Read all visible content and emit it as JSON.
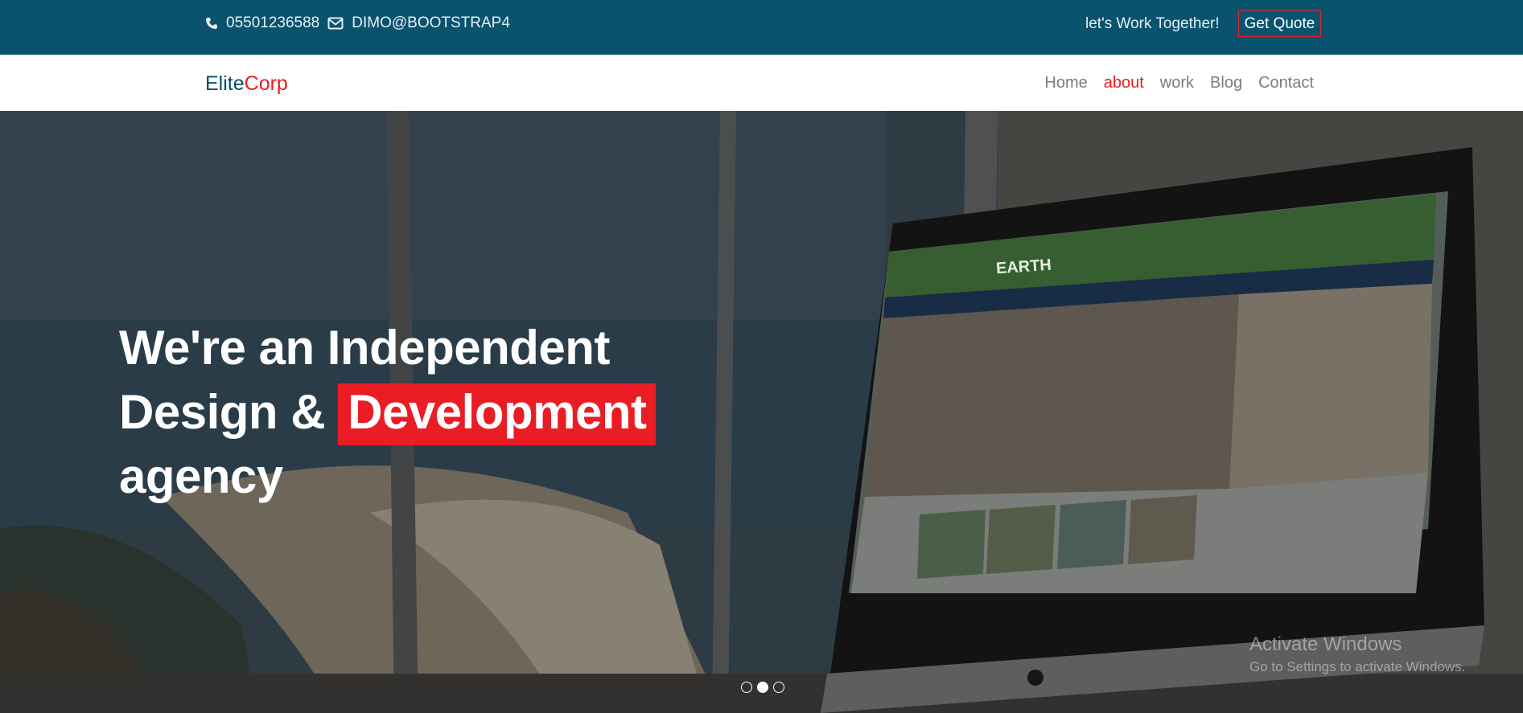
{
  "topbar": {
    "phone": "05501236588",
    "email": "DIMO@BOOTSTRAP4",
    "tagline": "let's Work Together!",
    "quote_button": "Get Quote"
  },
  "navbar": {
    "brand_part1": "Elite",
    "brand_part2": "Corp",
    "links": [
      "Home",
      "about",
      "work",
      "Blog",
      "Contact"
    ],
    "active_link": "about"
  },
  "hero": {
    "line1": "We're an Independent",
    "line2_prefix": "Design & ",
    "line2_highlight": "Development",
    "line3": "agency",
    "carousel_total": 3,
    "carousel_active": 2
  },
  "screen_mockup": {
    "logo_text": "EARTH"
  },
  "watermark": {
    "title": "Activate Windows",
    "subtitle": "Go to Settings to activate Windows."
  },
  "colors": {
    "topbar_bg": "#09536f",
    "accent_red": "#ea1c24",
    "brand_dark": "#0a4d68",
    "nav_text": "#7b7b7b",
    "mockup_green": "#4a9a3c",
    "mockup_blue": "#1d3f7a"
  },
  "icons": [
    "phone-icon",
    "envelope-icon"
  ]
}
